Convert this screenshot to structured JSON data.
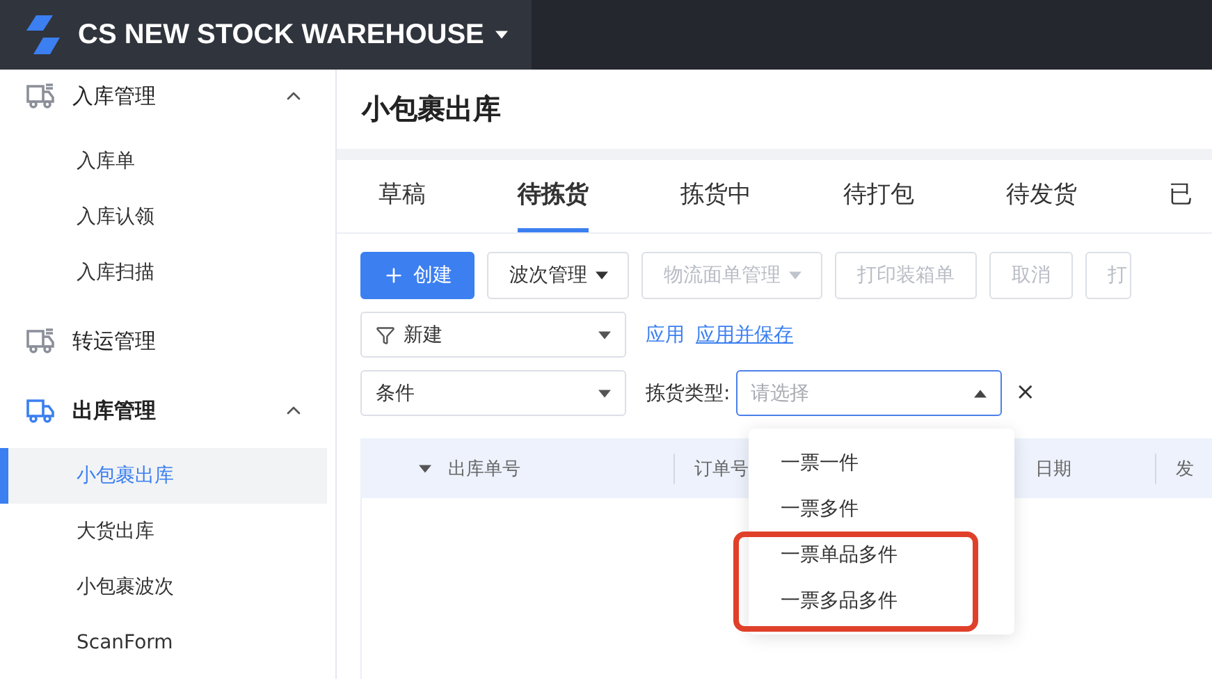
{
  "header": {
    "title": "CS NEW STOCK WAREHOUSE"
  },
  "sidebar": {
    "groups": [
      {
        "label": "入库管理",
        "active": false,
        "expanded": true,
        "items": [
          {
            "label": "入库单",
            "selected": false
          },
          {
            "label": "入库认领",
            "selected": false
          },
          {
            "label": "入库扫描",
            "selected": false
          }
        ]
      },
      {
        "label": "转运管理",
        "active": false
      },
      {
        "label": "出库管理",
        "active": true,
        "expanded": true,
        "items": [
          {
            "label": "小包裹出库",
            "selected": true
          },
          {
            "label": "大货出库",
            "selected": false
          },
          {
            "label": "小包裹波次",
            "selected": false
          },
          {
            "label": "ScanForm",
            "selected": false
          }
        ]
      }
    ]
  },
  "page_title": "小包裹出库",
  "tabs": [
    {
      "label": "草稿",
      "selected": false
    },
    {
      "label": "待拣货",
      "selected": true
    },
    {
      "label": "拣货中",
      "selected": false
    },
    {
      "label": "待打包",
      "selected": false
    },
    {
      "label": "待发货",
      "selected": false
    },
    {
      "label": "已",
      "selected": false
    }
  ],
  "toolbar": [
    {
      "label": "创建",
      "kind": "primary",
      "disabled": false
    },
    {
      "label": "波次管理",
      "kind": "dropdown",
      "disabled": false
    },
    {
      "label": "物流面单管理",
      "kind": "dropdown",
      "disabled": true
    },
    {
      "label": "打印装箱单",
      "kind": "plain",
      "disabled": true
    },
    {
      "label": "取消",
      "kind": "plain",
      "disabled": true
    },
    {
      "label": "打",
      "kind": "plain",
      "disabled": true
    }
  ],
  "filter": {
    "preset": "新建",
    "links": [
      {
        "label": "应用",
        "underlined": false
      },
      {
        "label": "应用并保存",
        "underlined": true
      }
    ]
  },
  "condition": {
    "field": "条件",
    "label": "拣货类型:",
    "placeholder": "请选择",
    "open": true,
    "clear": "×",
    "options": [
      {
        "label": "一票一件",
        "highlighted": false
      },
      {
        "label": "一票多件",
        "highlighted": false
      },
      {
        "label": "一票单品多件",
        "highlighted": true
      },
      {
        "label": "一票多品多件",
        "highlighted": true
      }
    ]
  },
  "table": {
    "columns": [
      "出库单号",
      "订单号",
      "日期",
      "发"
    ]
  }
}
